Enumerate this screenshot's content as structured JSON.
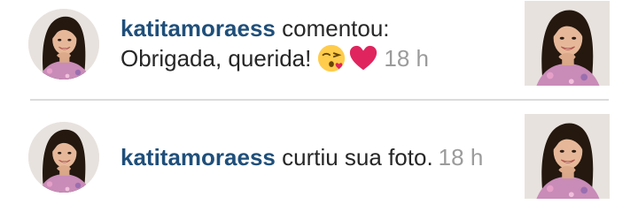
{
  "notifications": [
    {
      "username": "katitamoraess",
      "action": "comentou:",
      "comment": "Obrigada, querida!",
      "emojis": [
        "kiss-face-emoji",
        "red-heart-emoji"
      ],
      "time": "18 h"
    },
    {
      "username": "katitamoraess",
      "action": "curtiu sua foto.",
      "time": "18 h"
    }
  ],
  "colors": {
    "username": "#1f4f7a",
    "text": "#262626",
    "timestamp": "#9b9b9b",
    "divider": "#dbdbdb"
  }
}
